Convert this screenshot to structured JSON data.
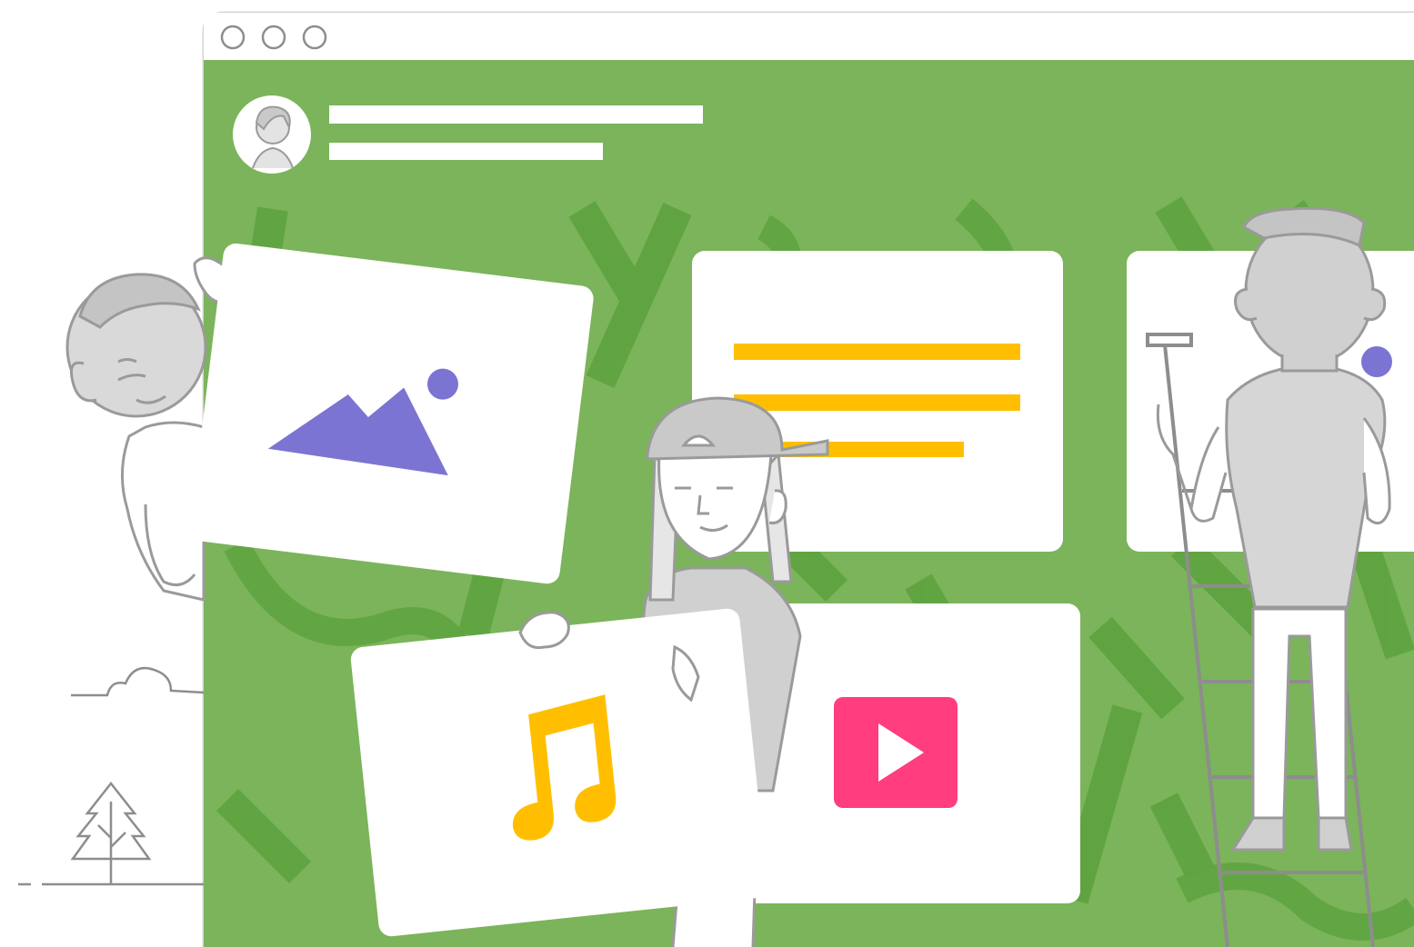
{
  "illustration": {
    "colors": {
      "background": "#ffffff",
      "window_frame": "#d5d5d5",
      "canvas": "#7bb45a",
      "canvas_stripe": "#5ea33f",
      "card": "#ffffff",
      "line_art": "#9a9a9a",
      "figure_fill": "#d6d6d6",
      "image_icon": "#7c74d2",
      "text_lines": "#ffbf00",
      "music_icon": "#ffbf00",
      "play_icon": "#ff3d7f",
      "accent_dot": "#7c74d2"
    },
    "window_controls": [
      "close-control",
      "minimize-control",
      "maximize-control"
    ],
    "profile": {
      "avatar_icon": "person-avatar-icon"
    },
    "cards": [
      {
        "name": "image-card",
        "icon": "image-icon"
      },
      {
        "name": "text-card",
        "icon": "text-lines-icon"
      },
      {
        "name": "ladder-card",
        "icon": "accent-dot-icon"
      },
      {
        "name": "music-card",
        "icon": "music-note-icon"
      },
      {
        "name": "video-card",
        "icon": "play-icon"
      }
    ],
    "figures": [
      "person-peeking-left",
      "person-cap-center",
      "person-on-ladder-right"
    ],
    "scenery": [
      "cloud-icon",
      "tree-icon",
      "ground-line"
    ]
  }
}
